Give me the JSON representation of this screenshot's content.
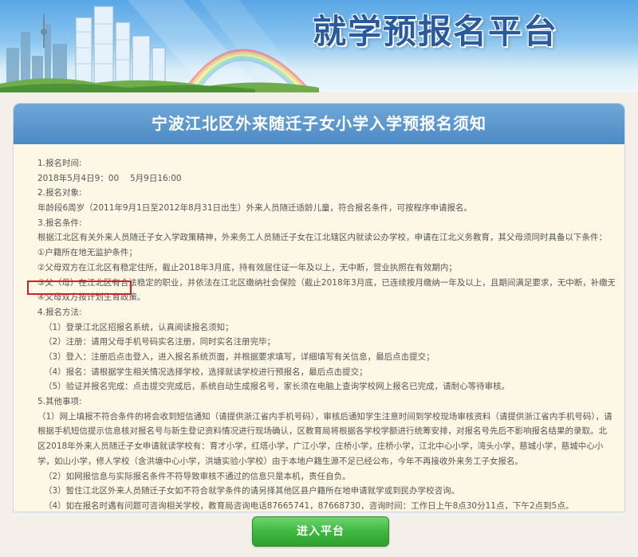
{
  "banner": {
    "title": "就学预报名平台"
  },
  "notice": {
    "title": "宁波江北区外来随迁子女小学入学预报名须知",
    "lines": [
      "1.报名时间:",
      "2018年5月4日9：00 　5月9日16:00",
      "2.报名对象:",
      "年龄段6周岁（2011年9月1日至2012年8月31日出生）外来人员随迁适龄儿童，符合报名条件，可按程序申请报名。",
      "3.报名条件:",
      "根据江北区有关外来人员随迁子女入学政策精神，外来务工人员随迁子女在江北辖区内就读公办学校，申请在江北义务教育，其父母须同时具备以下条件：",
      "①户籍所在地无监护条件；",
      "②父母双方在江北区有稳定住所，截止2018年3月底，持有效居住证一年及以上，无中断，营业执照在有效期内；",
      "③父（母）在江北区有合法稳定的职业，并依法在江北区缴纳社会保险（截止2018年3月底，已连续按月缴纳一年及以上，且期间满足要求，无中断，补缴无效）。",
      "④父母双方按计划生育政策。",
      "4.报名方法:",
      "（1）登录江北区招报名系统，认真阅读报名须知；",
      "（2）注册：请用父母手机号码实名注册，同时实名注册完毕；",
      "（3）登入：注册后点击登入，进入报名系统页面，并根据要求填写，详细填写有关信息，最后点击提交；",
      "（4）报名：请根据学生相关情况选择学校，选择就读学校进行预报名，最后点击提交；",
      "（5）验证并报名完成：点击提交完成后，系统自动生成报名号，家长须在电脑上查询学校网上报名已完成，请耐心等待审核。",
      "5.其他事项:",
      "（1）网上填报不符合条件的将会收到短信通知（请提供浙江省内手机号码），审核后通知学生注意时间到学校现场审核资料（请提供浙江省内手机号码），请根据手机短信提示信息核对报名号与新生登记资料情况进行现场确认，区教育局将根据各学校学额进行统筹安排，对报名号先后不影响报名结果的录取。北区2018年外来人员随迁子女申请就读学校有：育才小学，红塔小学，广江小学，庄桥小学，庄桥小学，江北中心小学，湾头小学，慈城小学，慈城中心小学，如山小学，修人学校（含洪塘中心小学，洪塘实验小学校）由于本地户籍生源不足已经公布，今年不再接收外来务工子女报名。",
      "（2）如网报信息与实际报名条件不符导致审核不通过的信息只是本机，责任自负。",
      "（3）暂住江北区外来人员随迁子女如不符合就学条件的请另择其他区县户籍所在地申请就学或到民办学校咨询。",
      "（4）如在报名时遇有问题可咨询相关学校，教育局咨询电话87665741，87668730，咨询时间：工作日上午8点30分11点，下午2点到5点。"
    ]
  },
  "actions": {
    "enter_label": "进入平台"
  },
  "colors": {
    "header_blue": "#4d89c4",
    "panel_bg": "#fdf8e6",
    "highlight_red": "#d81e1e",
    "button_green": "#3fb83f"
  }
}
